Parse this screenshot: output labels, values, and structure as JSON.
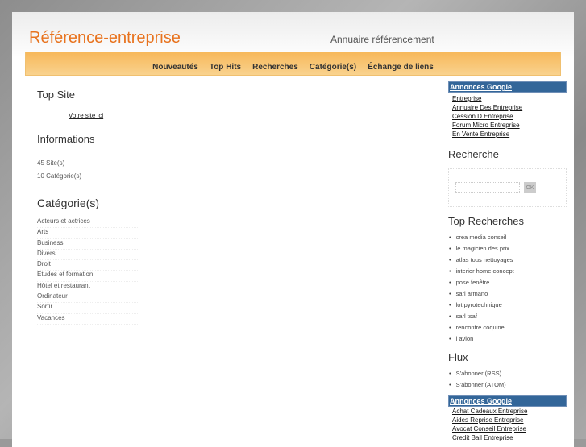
{
  "header": {
    "title": "Référence-entreprise",
    "tagline": "Annuaire référencement"
  },
  "nav": [
    "Nouveautés",
    "Top Hits",
    "Recherches",
    "Catégorie(s)",
    "Échange de liens"
  ],
  "left": {
    "top_site_title": "Top Site",
    "top_site_link": "Votre site ici",
    "info_title": "Informations",
    "info": [
      "45 Site(s)",
      "10 Catégorie(s)"
    ],
    "cat_title": "Catégorie(s)",
    "categories": [
      "Acteurs et actrices",
      "Arts",
      "Business",
      "Divers",
      "Droit",
      "Etudes et formation",
      "Hôtel et restaurant",
      "Ordinateur",
      "Sortir",
      "Vacances"
    ]
  },
  "right": {
    "ads1_title": "Annonces Google",
    "ads1": [
      "Entreprise",
      "Annuaire Des Entreprise",
      "Cession D Entreprise",
      "Forum Micro Entreprise",
      "En Vente Entreprise"
    ],
    "search_title": "Recherche",
    "search_button": "OK",
    "top_title": "Top Recherches",
    "top": [
      "crea media conseil",
      "le magicien des prix",
      "atlas tous nettoyages",
      "interior home concept",
      "pose fenêtre",
      "sarl armano",
      "lot pyrotechnique",
      "sarl tsaf",
      "rencontre coquine",
      "i avion"
    ],
    "flux_title": "Flux",
    "flux": [
      "S'abonner (RSS)",
      "S'abonner (ATOM)"
    ],
    "ads2_title": "Annonces Google",
    "ads2": [
      "Achat Cadeaux Entreprise",
      "Aides Reprise Entreprise",
      "Avocat Conseil Entreprise",
      "Credit Bail Entreprise"
    ]
  }
}
